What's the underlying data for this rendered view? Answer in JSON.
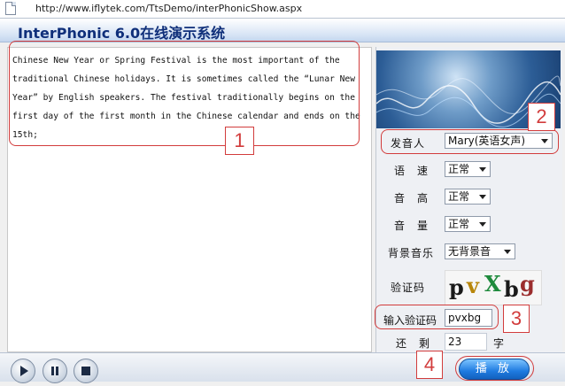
{
  "browser": {
    "url": "http://www.iflytek.com/TtsDemo/interPhonicShow.aspx"
  },
  "app": {
    "title": "InterPhonic 6.0在线演示系统"
  },
  "text_input": {
    "value": "Chinese New Year or Spring Festival is the most important of the traditional Chinese holidays. It is sometimes called the “Lunar New Year” by English speakers. The festival traditionally begins on the first day of the first month in the Chinese calendar and ends on the 15th;"
  },
  "settings": {
    "speaker_label": "发音人",
    "speaker_value": "Mary(英语女声)",
    "speed_label": "语　速",
    "speed_value": "正常",
    "pitch_label": "音　高",
    "pitch_value": "正常",
    "volume_label": "音　量",
    "volume_value": "正常",
    "bgm_label": "背景音乐",
    "bgm_value": "无背景音",
    "captcha_label": "验证码",
    "captcha_chars": [
      "p",
      "v",
      "X",
      "b",
      "g"
    ],
    "captcha_input_label": "输入验证码",
    "captcha_input_value": "pvxbg",
    "remaining_label": "还　剩",
    "remaining_value": "23",
    "remaining_unit": "字"
  },
  "controls": {
    "play_label": "播 放"
  },
  "annotations": [
    "1",
    "2",
    "3",
    "4"
  ],
  "colors": {
    "annotation": "#d23c3c",
    "title": "#0f2f7a",
    "play_button": "#1f7be0"
  }
}
